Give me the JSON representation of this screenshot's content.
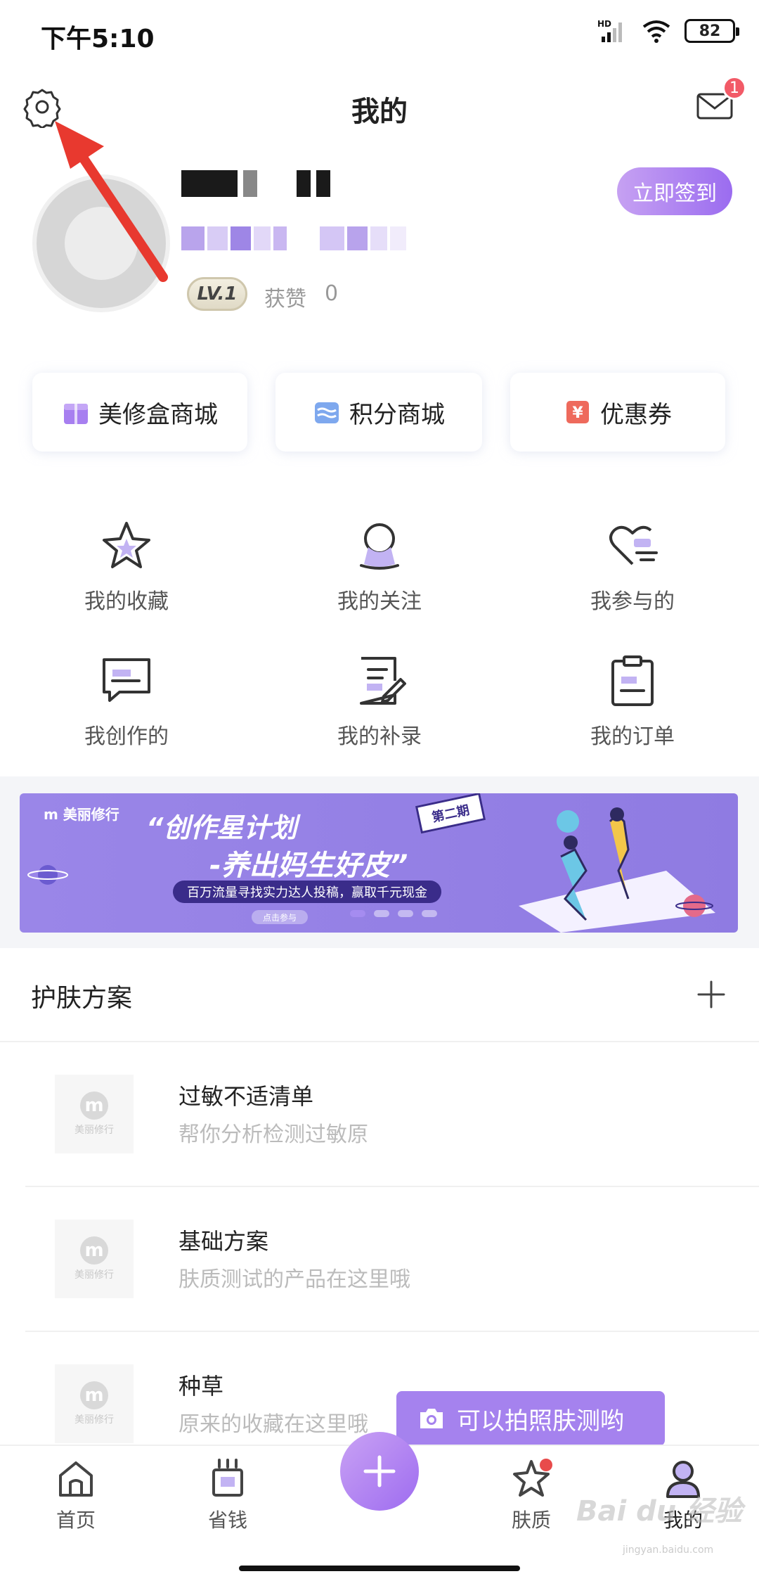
{
  "status_bar": {
    "time": "下午5:10",
    "network": "HD",
    "battery": "82"
  },
  "header": {
    "title": "我的",
    "mail_badge": "1"
  },
  "profile": {
    "lv_badge": "LV.1",
    "likes_label": "获赞",
    "likes_count": "0",
    "signin_label": "立即签到"
  },
  "shops": [
    {
      "label": "美修盒商城",
      "icon": "gift-box-icon",
      "color": "#a77ff0"
    },
    {
      "label": "积分商城",
      "icon": "points-icon",
      "color": "#7ea8ee"
    },
    {
      "label": "优惠券",
      "icon": "coupon-icon",
      "color": "#ee6a5c"
    }
  ],
  "grid": [
    {
      "label": "我的收藏",
      "icon": "star-icon"
    },
    {
      "label": "我的关注",
      "icon": "user-icon"
    },
    {
      "label": "我参与的",
      "icon": "heart-icon"
    },
    {
      "label": "我创作的",
      "icon": "chat-box-icon"
    },
    {
      "label": "我的补录",
      "icon": "edit-note-icon"
    },
    {
      "label": "我的订单",
      "icon": "clipboard-icon"
    }
  ],
  "banner": {
    "logo": "m 美丽修行",
    "title_line1": "“创作星计划",
    "title_line2": "-养出妈生好皮”",
    "subtitle": "百万流量寻找实力达人投稿，赢取千元现金",
    "button": "点击参与",
    "tag": "第二期"
  },
  "section": {
    "title": "护肤方案",
    "items": [
      {
        "title": "过敏不适清单",
        "desc": "帮你分析检测过敏原",
        "thumb_text": "美丽修行"
      },
      {
        "title": "基础方案",
        "desc": "肤质测试的产品在这里哦",
        "thumb_text": "美丽修行"
      },
      {
        "title": "种草",
        "desc": "原来的收藏在这里哦",
        "thumb_text": "美丽修行"
      }
    ]
  },
  "tooltip": {
    "text": "可以拍照肤测哟"
  },
  "tabbar": {
    "items": [
      {
        "label": "首页",
        "icon": "home-icon"
      },
      {
        "label": "省钱",
        "icon": "save-money-icon"
      },
      {
        "label": "肤质",
        "icon": "skin-icon"
      },
      {
        "label": "我的",
        "icon": "profile-icon"
      }
    ]
  },
  "watermark": {
    "text": "Bai du 经验",
    "url": "jingyan.baidu.com"
  },
  "colors": {
    "accent": "#9b6cf0",
    "annotation_arrow": "#e8392f"
  }
}
